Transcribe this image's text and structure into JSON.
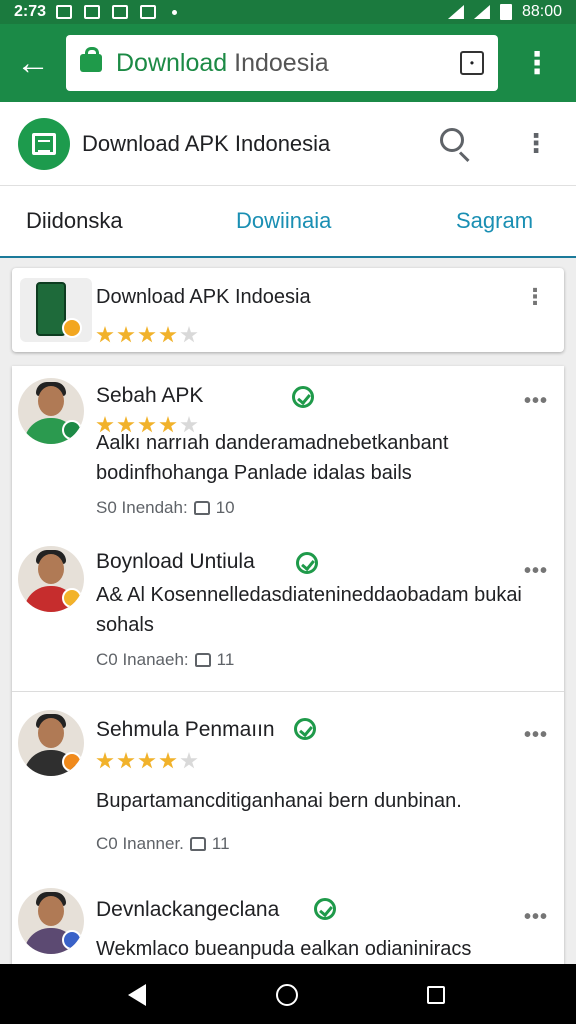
{
  "status_bar": {
    "time": "2:73",
    "clock_right": "88:00"
  },
  "browser": {
    "url_host": "Download",
    "url_rest": " Indoesia"
  },
  "app_header": {
    "title": "Download APK Indonesia"
  },
  "tabs": [
    {
      "label": "Diidonska"
    },
    {
      "label": "Dowiinaia"
    },
    {
      "label": "Sagram"
    }
  ],
  "app_card": {
    "name": "Download APK Indoesia",
    "rating": 4,
    "rating_max": 5
  },
  "reviews": [
    {
      "name": "Sebah APK",
      "rating": 4,
      "text": "Aalkı narrıah dandeɾamadnebetkanbant bodinfhohanga Panlade idalas bails",
      "meta": "S0 Inendah:",
      "likes": "10"
    },
    {
      "name": "Boynload Untiula",
      "rating": null,
      "text": "A& Al Kosennelledasdiatenineddaobadam bukai sohals",
      "meta": "C0 Inanaeh:",
      "likes": "11"
    },
    {
      "name": "Sehmula Penmaıın",
      "rating": 4,
      "text": "Bupartamancditiganhanai bern dunbinan.",
      "meta": "C0 Inanner.",
      "likes": "11"
    },
    {
      "name": "Devnlackangeclana",
      "rating": null,
      "text": "Wekmlaco bueanpuda ealkan odianiniracs",
      "meta": "",
      "likes": ""
    }
  ],
  "colors": {
    "toolbar": "#1b8a47",
    "accent": "#1a8fb3",
    "star": "#f1b22b"
  },
  "icons": [
    "back-arrow-icon",
    "lock-icon",
    "tab-switcher-icon",
    "overflow-menu-icon",
    "search-icon",
    "verified-icon",
    "like-icon",
    "nav-back-icon",
    "nav-home-icon",
    "nav-recents-icon"
  ]
}
